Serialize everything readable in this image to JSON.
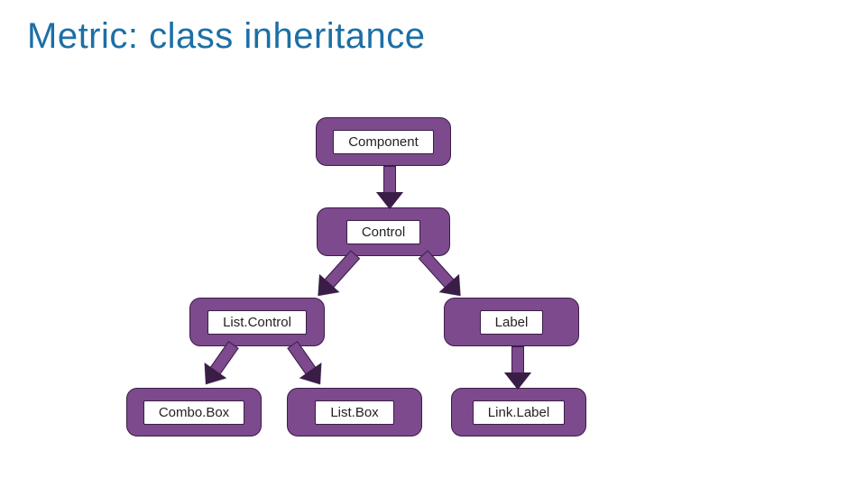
{
  "title": "Metric: class inheritance",
  "nodes": {
    "component": "Component",
    "control": "Control",
    "listcontrol": "List.Control",
    "label": "Label",
    "combobox": "Combo.Box",
    "listbox": "List.Box",
    "linklabel": "Link.Label"
  },
  "edges": [
    {
      "from": "component",
      "to": "control"
    },
    {
      "from": "control",
      "to": "listcontrol"
    },
    {
      "from": "control",
      "to": "label"
    },
    {
      "from": "listcontrol",
      "to": "combobox"
    },
    {
      "from": "listcontrol",
      "to": "listbox"
    },
    {
      "from": "label",
      "to": "linklabel"
    }
  ],
  "colors": {
    "node_fill": "#7c4a8d",
    "node_border": "#3a1d47",
    "title": "#1c6fa6"
  }
}
